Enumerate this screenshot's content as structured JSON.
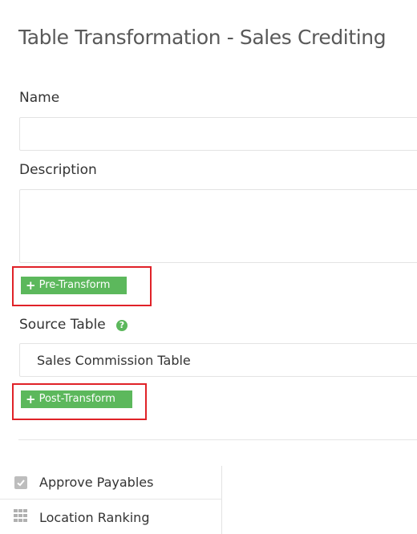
{
  "page": {
    "title": "Table Transformation - Sales Crediting"
  },
  "form": {
    "name_label": "Name",
    "name_value": "",
    "description_label": "Description",
    "description_value": "",
    "pre_transform_label": "Pre-Transform",
    "source_table_label": "Source Table",
    "source_table_value": "Sales Commission Table",
    "post_transform_label": "Post-Transform"
  },
  "icons": {
    "plus": "plus-icon",
    "help": "question-circle-icon",
    "check": "checkbox-icon",
    "grid": "grid-icon"
  },
  "help_symbol": "?",
  "plus_symbol": "+",
  "list": {
    "items": [
      {
        "label": "Approve Payables",
        "icon": "checkbox-icon"
      },
      {
        "label": "Location Ranking",
        "icon": "grid-icon"
      }
    ]
  },
  "colors": {
    "accent_green": "#5cb85c",
    "highlight_red": "#e02228"
  }
}
